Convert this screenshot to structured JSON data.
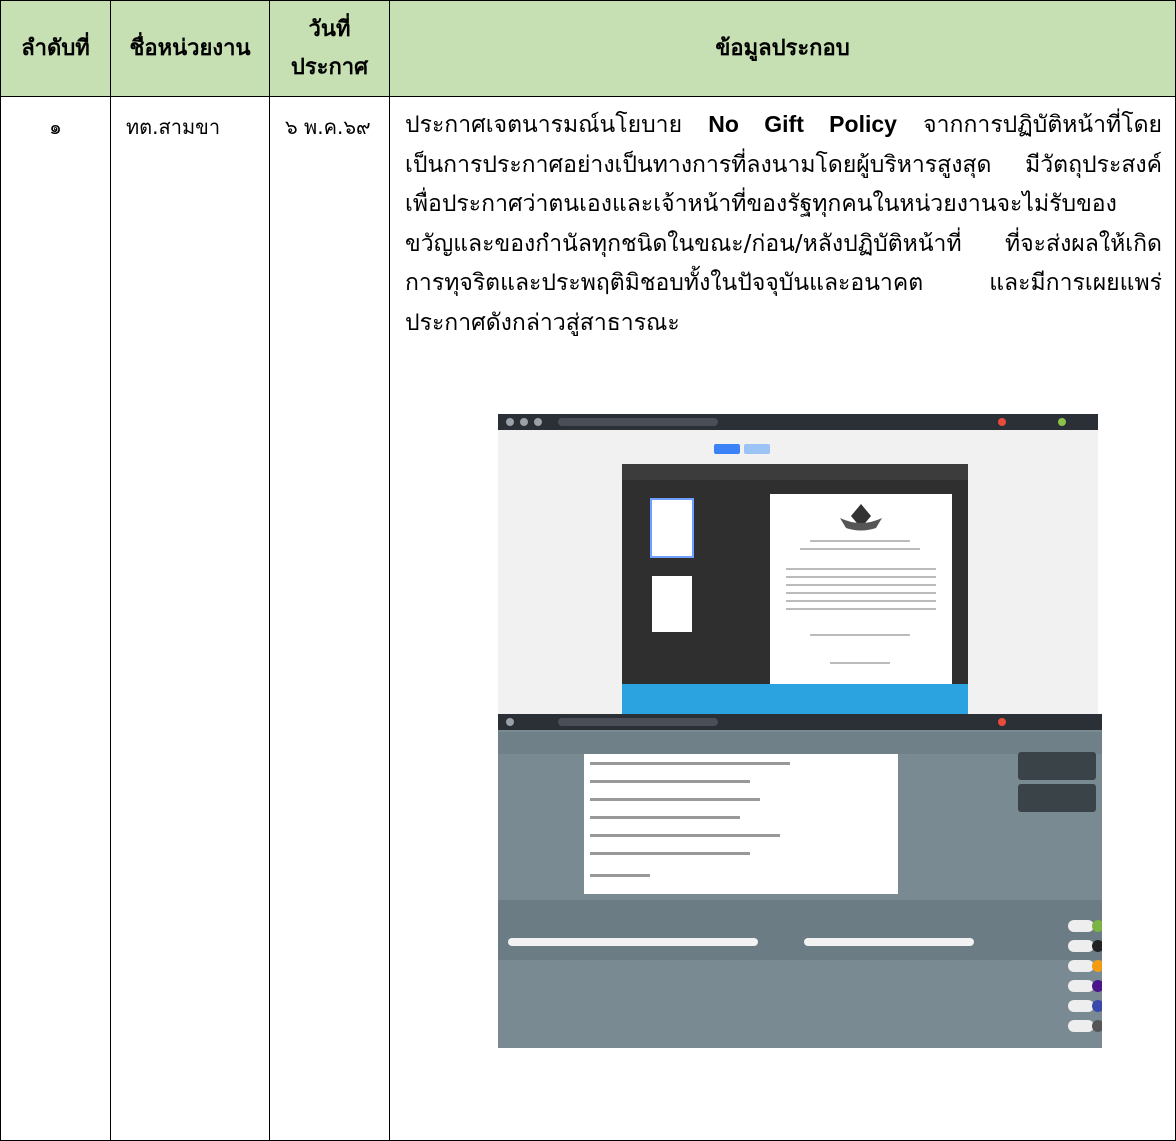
{
  "table": {
    "headers": {
      "order": "ลำดับที่",
      "agency": "ชื่อหน่วยงาน",
      "date_line1": "วันที่",
      "date_line2": "ประกาศ",
      "details": "ข้อมูลประกอบ"
    },
    "rows": [
      {
        "order": "๑",
        "agency": "ทต.สามขา",
        "date": "๖ พ.ค.๖๙",
        "details_before": "ประกาศเจตนารมณ์นโยบาย ",
        "details_highlight": "No Gift Policy",
        "details_after": " จากการปฏิบัติหน้าที่โดยเป็นการประกาศอย่างเป็นทางการที่ลงนามโดยผู้บริหารสูงสุด มีวัตถุประสงค์เพื่อประกาศว่าตนเองและเจ้าหน้าที่ของรัฐทุกคนในหน่วยงานจะไม่รับของขวัญและของกำนัลทุกชนิดในขณะ/ก่อน/หลังปฏิบัติหน้าที่ ที่จะส่งผลให้เกิดการทุจริตและประพฤติมิชอบทั้งในปัจจุบันและอนาคต และมีการเผยแพร่ประกาศดังกล่าวสู่สาธารณะ"
      }
    ]
  },
  "colors": {
    "header_bg": "#c6e0b4",
    "border": "#000000"
  }
}
